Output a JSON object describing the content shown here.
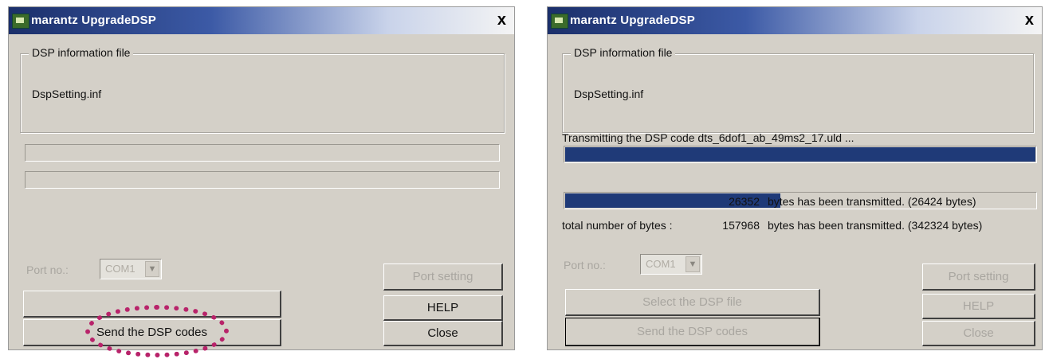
{
  "window1": {
    "title": "marantz UpgradeDSP",
    "close": "x",
    "group_label": "DSP information file",
    "filename": "DspSetting.inf",
    "port_label": "Port no.:",
    "port_value": "COM1",
    "buttons": {
      "top_right": "Port setting",
      "help": "HELP",
      "send": "Send the DSP codes",
      "close": "Close"
    },
    "progress": [
      0,
      0
    ]
  },
  "window2": {
    "title": "marantz UpgradeDSP",
    "close": "x",
    "group_label": "DSP information file",
    "filename": "DspSetting.inf",
    "transmitting": "Transmitting the DSP code dts_6dof1_ab_49ms2_17.uld ...",
    "progress": [
      1.0,
      0.46
    ],
    "line1": {
      "count": "26352",
      "text": "bytes has been transmitted. (26424 bytes)"
    },
    "line2": {
      "label": "total number of bytes :",
      "count": "157968",
      "text": "bytes has been transmitted. (342324 bytes)"
    },
    "port_label": "Port no.:",
    "port_value": "COM1",
    "buttons": {
      "top_left": "Select the DSP file",
      "top_right": "Port setting",
      "help": "HELP",
      "send": "Send the DSP codes",
      "close": "Close"
    }
  }
}
